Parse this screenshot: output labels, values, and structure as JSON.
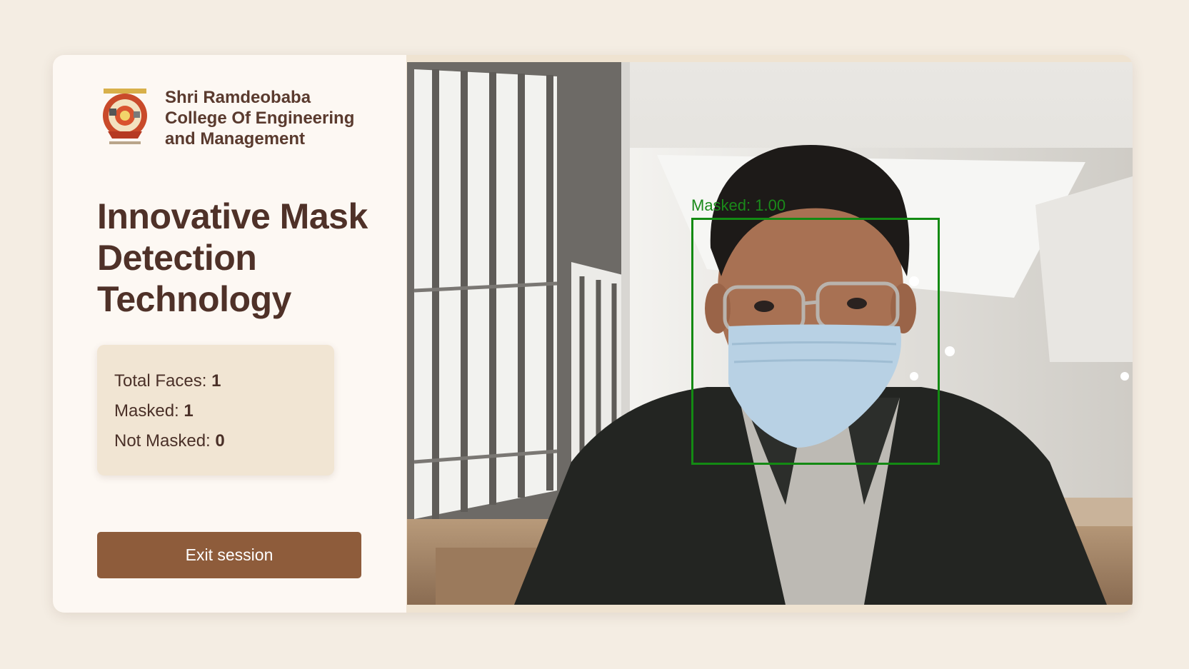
{
  "brand": {
    "college_name": "Shri Ramdeobaba College Of Engineering and Management",
    "logo_icon": "college-crest-icon"
  },
  "page": {
    "title": "Innovative Mask Detection Technology"
  },
  "stats": {
    "total_faces_label": "Total Faces: ",
    "total_faces_value": "1",
    "masked_label": "Masked: ",
    "masked_value": "1",
    "not_masked_label": "Not Masked: ",
    "not_masked_value": "0"
  },
  "actions": {
    "exit_label": "Exit session"
  },
  "video": {
    "detections": [
      {
        "label": "Masked: 1.00",
        "color": "#138a13"
      }
    ]
  },
  "colors": {
    "page_bg": "#f4ede3",
    "sidebar_bg": "#fdf8f3",
    "title": "#4f3128",
    "stats_bg": "#f1e5d3",
    "button_bg": "#8e5c3b",
    "detection_green": "#138a13"
  }
}
